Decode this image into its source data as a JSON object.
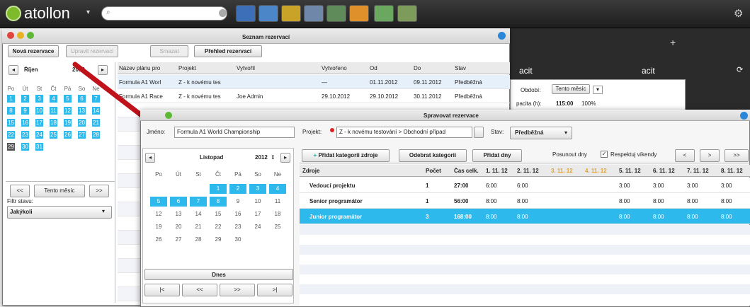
{
  "app": {
    "logo": "atollon",
    "logo_caret": "▾",
    "search_placeholder": ""
  },
  "toolbar_icons": [
    "users-icon",
    "calendar-icon",
    "chart-icon",
    "table-icon",
    "grid-icon",
    "checkmark-icon",
    "gantt-icon",
    "resource-icon"
  ],
  "dark": {
    "plus": "+",
    "title": "acit",
    "right_title": "acit",
    "refresh": "⟳",
    "obdobi_label": "Období:",
    "obdobi_value": "Tento měsíc",
    "kap_label": "pacita (h):",
    "kap_value": "115:00",
    "kap_percent": "100%"
  },
  "winL": {
    "title": "Seznam rezervací",
    "buttons": {
      "new": "Nová rezervace",
      "edit": "Upravit rezervaci",
      "delete": "Smazat",
      "overview": "Přehled rezervací"
    },
    "cal": {
      "month": "Říjen",
      "year": "2012",
      "days": [
        "Po",
        "Út",
        "St",
        "Čt",
        "Pá",
        "So",
        "Ne"
      ],
      "rows": [
        [
          "1",
          "2",
          "3",
          "4",
          "5",
          "6",
          "7"
        ],
        [
          "8",
          "9",
          "10",
          "11",
          "12",
          "13",
          "14"
        ],
        [
          "15",
          "16",
          "17",
          "18",
          "19",
          "20",
          "21"
        ],
        [
          "22",
          "23",
          "24",
          "25",
          "26",
          "27",
          "28"
        ],
        [
          "29",
          "30",
          "31",
          "",
          "",
          "",
          ""
        ]
      ]
    },
    "this_month": "Tento měsíc",
    "prev": "<<",
    "next": ">>",
    "filter_label": "Filtr stavu:",
    "filter_value": "Jakýkoli",
    "columns": [
      "Název plánu pro",
      "Projekt",
      "Vytvořil",
      "Vytvořeno",
      "Od",
      "Do",
      "Stav"
    ],
    "rows": [
      [
        "Formula A1 Worl",
        "Z - k novému tes",
        "",
        "—",
        "01.11.2012",
        "09.11.2012",
        "Předběžná"
      ],
      [
        "Formula A1 Race",
        "Z - k novému tes",
        "Joe Admin",
        "29.10.2012",
        "29.10.2012",
        "30.11.2012",
        "Předběžná"
      ]
    ]
  },
  "winR": {
    "title": "Spravovat rezervace",
    "name_label": "Jméno:",
    "name_value": "Formula A1 World Championship",
    "project_label": "Projekt:",
    "project_value": "Z - k novému testování > Obchodní případ",
    "status_label": "Stav:",
    "status_value": "Předběžná",
    "cal": {
      "month": "Listopad",
      "year": "2012",
      "days": [
        "Po",
        "Út",
        "St",
        "Čt",
        "Pá",
        "So",
        "Ne"
      ],
      "rows": [
        [
          "",
          "",
          "",
          "1",
          "2",
          "3",
          "4"
        ],
        [
          "5",
          "6",
          "7",
          "8",
          "9",
          "10",
          "11"
        ],
        [
          "12",
          "13",
          "14",
          "15",
          "16",
          "17",
          "18"
        ],
        [
          "19",
          "20",
          "21",
          "22",
          "23",
          "24",
          "25"
        ],
        [
          "26",
          "27",
          "28",
          "29",
          "30",
          "",
          ""
        ]
      ]
    },
    "today": "Dnes",
    "nav": [
      "|<",
      "<<",
      ">>",
      ">|"
    ],
    "buttons": {
      "add": "Přidat kategorii zdroje",
      "remove": "Odebrat kategorii",
      "add_days": "Přidat dny"
    },
    "shift_label": "Posunout dny",
    "respect_label": "Respektuj víkendy",
    "nav_small": [
      "<",
      ">",
      ">>"
    ],
    "columns": [
      "Zdroje",
      "Počet",
      "Čas celk.",
      "1. 11. 12",
      "2. 11. 12",
      "3. 11. 12",
      "4. 11. 12",
      "5. 11. 12",
      "6. 11. 12",
      "7. 11. 12",
      "8. 11. 12"
    ],
    "rows": [
      [
        "Vedoucí projektu",
        "1",
        "27:00",
        "6:00",
        "6:00",
        "",
        "",
        "3:00",
        "3:00",
        "3:00",
        "3:00"
      ],
      [
        "Senior programátor",
        "1",
        "56:00",
        "8:00",
        "8:00",
        "",
        "",
        "8:00",
        "8:00",
        "8:00",
        "8:00"
      ],
      [
        "Junior programátor",
        "3",
        "168:00",
        "8:00",
        "8:00",
        "",
        "",
        "8:00",
        "8:00",
        "8:00",
        "8:00"
      ]
    ]
  },
  "colors": {
    "accent": "#2db9ec",
    "weekend": "#e8a020",
    "arrow": "#c0121b"
  }
}
